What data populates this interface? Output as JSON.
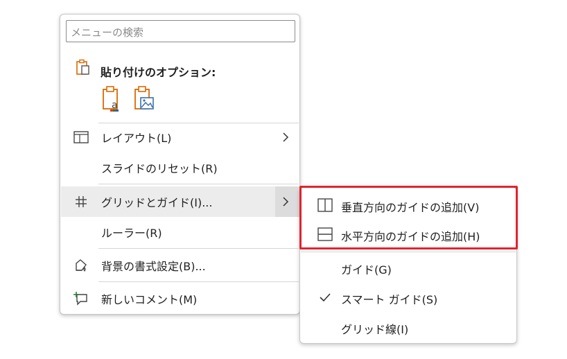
{
  "context_menu": {
    "search_placeholder": "メニューの検索",
    "paste_options_title": "貼り付けのオプション:",
    "paste_options": [
      {
        "name": "keep-text-only",
        "icon": "clipboard-text-icon"
      },
      {
        "name": "picture",
        "icon": "clipboard-picture-icon"
      }
    ],
    "items": [
      {
        "label": "レイアウト(L)",
        "icon": "layout-icon",
        "submenu": true
      },
      {
        "label": "スライドのリセット(R)",
        "icon": "",
        "submenu": false
      },
      {
        "label": "グリッドとガイド(I)...",
        "icon": "grid-icon",
        "submenu": true,
        "highlighted": true
      },
      {
        "label": "ルーラー(R)",
        "icon": "",
        "submenu": false
      },
      {
        "label": "背景の書式設定(B)...",
        "icon": "format-background-icon",
        "submenu": false
      },
      {
        "label": "新しいコメント(M)",
        "icon": "new-comment-icon",
        "submenu": false
      }
    ]
  },
  "submenu": {
    "items": [
      {
        "label": "垂直方向のガイドの追加(V)",
        "icon": "vertical-guide-icon"
      },
      {
        "label": "水平方向のガイドの追加(H)",
        "icon": "horizontal-guide-icon"
      },
      {
        "label": "ガイド(G)",
        "icon": "",
        "checked": false
      },
      {
        "label": "スマート ガイド(S)",
        "icon": "checkmark-icon",
        "checked": true
      },
      {
        "label": "グリッド線(I)",
        "icon": "",
        "checked": false
      }
    ]
  },
  "colors": {
    "highlight_box": "#e0242e",
    "hover_row": "#ececec",
    "paste_accent": "#d86a00"
  }
}
